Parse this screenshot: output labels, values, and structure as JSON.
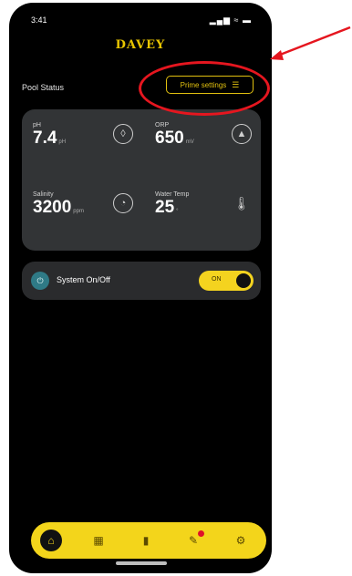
{
  "status_bar": {
    "time": "3:41",
    "icons": "..ll ≈ ■"
  },
  "header": {
    "brand": "DAVEY"
  },
  "pool": {
    "title": "Pool Status",
    "prime_settings_label": "Prime settings"
  },
  "metrics": [
    {
      "label": "pH",
      "value": "7.4",
      "unit": "pH"
    },
    {
      "label": "ORP",
      "value": "650",
      "unit": "mV"
    },
    {
      "label": "Salinity",
      "value": "3200",
      "unit": "ppm"
    },
    {
      "label": "Water Temp",
      "value": "25",
      "unit": "°"
    }
  ],
  "system": {
    "label": "System On/Off",
    "switch_text": "ON",
    "state": "on"
  },
  "tabs": [
    {
      "name": "home",
      "active": true
    },
    {
      "name": "calendar",
      "active": false
    },
    {
      "name": "stats",
      "active": false
    },
    {
      "name": "tools",
      "active": false,
      "badge": true
    },
    {
      "name": "settings",
      "active": false
    }
  ],
  "colors": {
    "accent": "#f3d51b",
    "background": "#000000",
    "card": "#323436",
    "annotation": "#e5161f"
  }
}
